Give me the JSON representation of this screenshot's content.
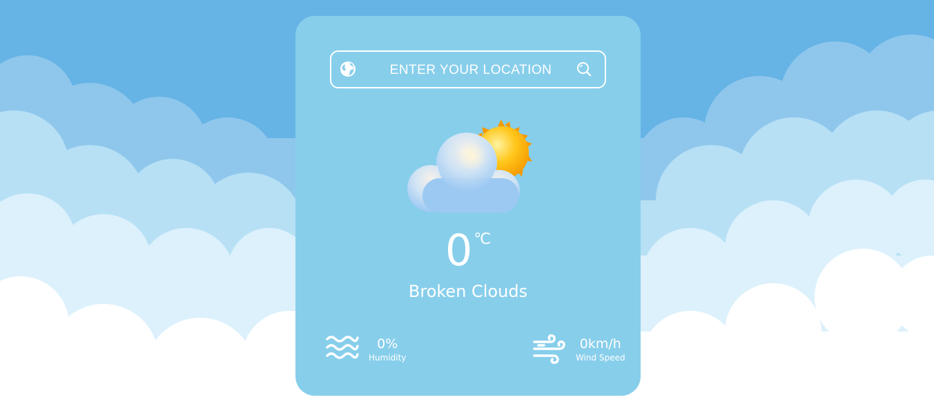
{
  "search": {
    "placeholder": "ENTER YOUR LOCATION",
    "value": ""
  },
  "weather": {
    "icon": "broken-clouds-icon",
    "temperature": "0",
    "unit": "℃",
    "description": "Broken Clouds"
  },
  "humidity": {
    "icon": "humidity-waves-icon",
    "value": "0%",
    "label": "Humidity"
  },
  "wind": {
    "icon": "wind-icon",
    "value": "0km/h",
    "label": "Wind Speed"
  },
  "colors": {
    "sky": "#66b3e6",
    "card": "#87ceeb",
    "cloud_far": "#8fc7ec",
    "cloud_mid": "#b7e0f5",
    "cloud_near": "#ffffff",
    "text": "#ffffff"
  }
}
